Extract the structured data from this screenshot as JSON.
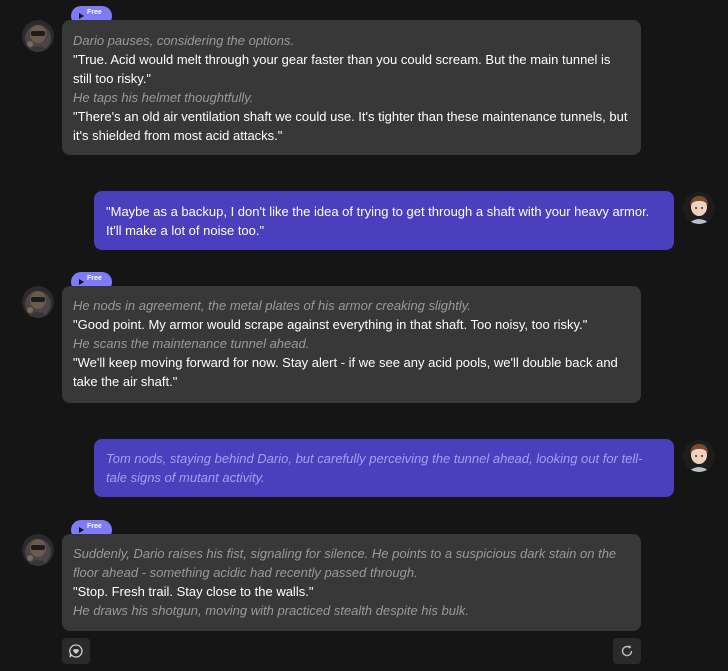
{
  "badge_label": "Free",
  "messages": [
    {
      "role": "bot",
      "lines": [
        {
          "type": "narration",
          "text": "Dario pauses, considering the options."
        },
        {
          "type": "speech",
          "text": "\"True. Acid would melt through your gear faster than you could scream. But the main tunnel is still too risky.\""
        },
        {
          "type": "narration",
          "text": "He taps his helmet thoughtfully."
        },
        {
          "type": "speech",
          "text": "\"There's an old air ventilation shaft we could use. It's tighter than these maintenance tunnels, but it's shielded from most acid attacks.\""
        }
      ]
    },
    {
      "role": "user",
      "lines": [
        {
          "type": "speech",
          "text": "\"Maybe as a backup, I don't like the idea of trying to get through a shaft with your heavy armor. It'll make a lot of noise too.\""
        }
      ]
    },
    {
      "role": "bot",
      "lines": [
        {
          "type": "narration",
          "text": "He nods in agreement, the metal plates of his armor creaking slightly."
        },
        {
          "type": "speech",
          "text": "\"Good point. My armor would scrape against everything in that shaft. Too noisy, too risky.\""
        },
        {
          "type": "narration",
          "text": "He scans the maintenance tunnel ahead."
        },
        {
          "type": "speech",
          "text": "\"We'll keep moving forward for now. Stay alert - if we see any acid pools, we'll double back and take the air shaft.\""
        }
      ]
    },
    {
      "role": "user",
      "lines": [
        {
          "type": "narration",
          "text": "Tom nods, staying behind Dario, but carefully perceiving the tunnel ahead, looking out for tell-tale signs of mutant activity."
        }
      ]
    },
    {
      "role": "bot",
      "lines": [
        {
          "type": "narration",
          "text": "Suddenly, Dario raises his fist, signaling for silence. He points to a suspicious dark stain on the floor ahead - something acidic had recently passed through."
        },
        {
          "type": "speech",
          "text": "\"Stop. Fresh trail. Stay close to the walls.\""
        },
        {
          "type": "narration",
          "text": "He draws his shotgun, moving with practiced stealth despite his bulk."
        }
      ]
    }
  ],
  "colors": {
    "background": "#151515",
    "bot_bubble": "#383838",
    "user_bubble": "#4a3fbd",
    "badge": "#7e7bf7"
  },
  "icons": [
    "play-icon",
    "heart-chat-icon",
    "regenerate-icon",
    "bot-avatar",
    "user-avatar"
  ]
}
